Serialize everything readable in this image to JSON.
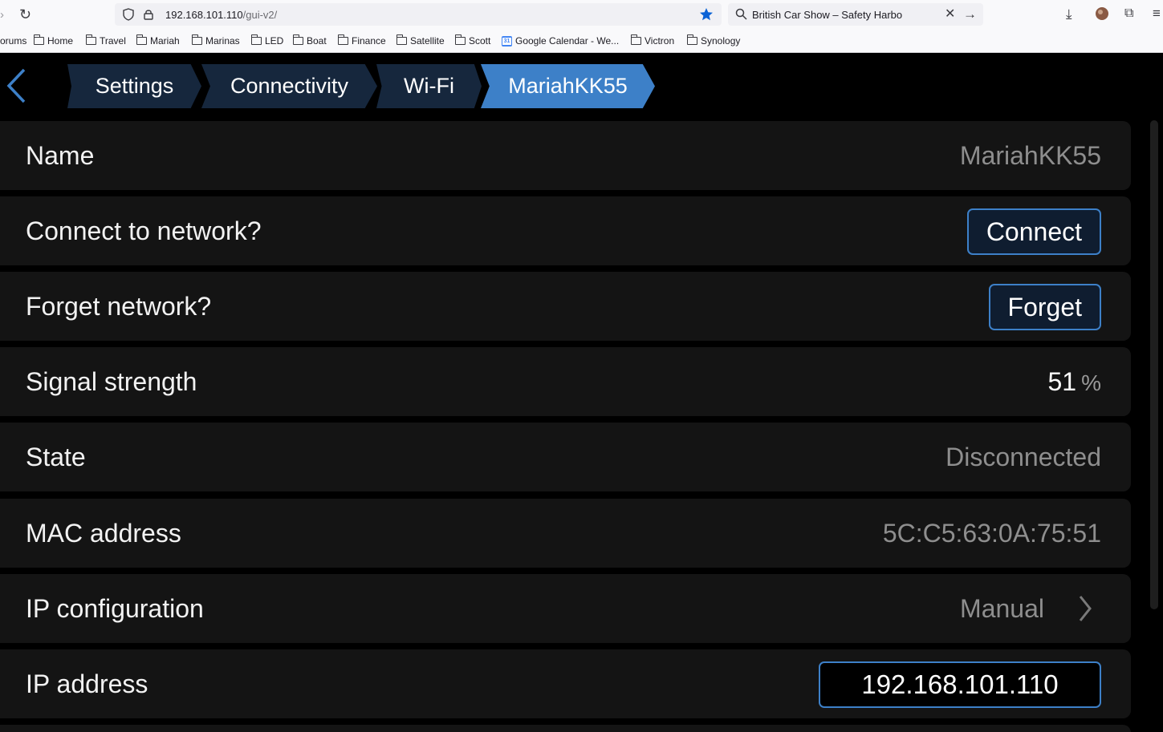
{
  "browser": {
    "url_host": "192.168.101.110",
    "url_path": "/gui-v2/",
    "search_text": "British Car Show – Safety Harbo",
    "bookmarks": [
      "orums",
      "Home",
      "Travel",
      "Mariah",
      "Marinas",
      "LED",
      "Boat",
      "Finance",
      "Satellite",
      "Scott",
      "Google Calendar - We...",
      "Victron",
      "Synology"
    ]
  },
  "breadcrumbs": [
    "Settings",
    "Connectivity",
    "Wi-Fi",
    "MariahKK55"
  ],
  "rows": {
    "name": {
      "label": "Name",
      "value": "MariahKK55"
    },
    "connect": {
      "label": "Connect to network?",
      "button": "Connect"
    },
    "forget": {
      "label": "Forget network?",
      "button": "Forget"
    },
    "signal": {
      "label": "Signal strength",
      "value": "51",
      "unit": "%"
    },
    "state": {
      "label": "State",
      "value": "Disconnected"
    },
    "mac": {
      "label": "MAC address",
      "value": "5C:C5:63:0A:75:51"
    },
    "ipconfig": {
      "label": "IP configuration",
      "value": "Manual"
    },
    "ipaddress": {
      "label": "IP address",
      "value": "192.168.101.110"
    }
  },
  "colors": {
    "accent": "#3d80c8",
    "crumb_dark": "#16273d",
    "row_bg": "#141414"
  }
}
